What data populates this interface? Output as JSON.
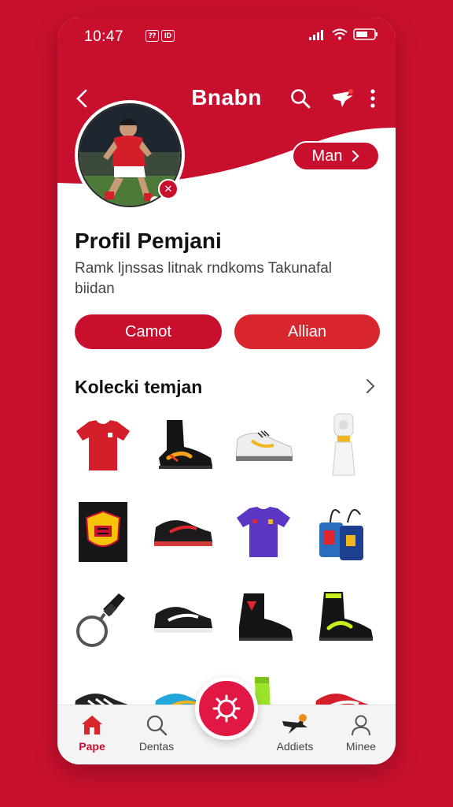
{
  "status_bar": {
    "time": "10:47",
    "notif": [
      "⁇",
      "ID"
    ]
  },
  "app_bar": {
    "title": "Bnabn"
  },
  "profile": {
    "more_label": "Man",
    "title": "Profil Pemjani",
    "description": "Ramk ljnssas litnak rndkoms Takunafal biidan",
    "primary_button": "Camot",
    "secondary_button": "Allian"
  },
  "collection": {
    "title": "Kolecki temjan",
    "items": [
      "red-jersey-icon",
      "black-boot-icon",
      "white-sneaker-icon",
      "bottle-icon",
      "badge-icon",
      "black-sneaker-icon",
      "purple-jersey-icon",
      "bag-icon",
      "keychain-icon",
      "black-sneaker-icon",
      "black-boot-icon",
      "black-boot-icon",
      "black-sneaker-icon",
      "blue-sneaker-icon",
      "green-sock-icon",
      "red-sneaker-icon"
    ]
  },
  "bottom_nav": {
    "items": [
      {
        "label": "Pape",
        "icon": "home-icon",
        "active": true
      },
      {
        "label": "Dentas",
        "icon": "search-icon",
        "active": false
      },
      {
        "label": "Addiets",
        "icon": "jet-icon",
        "active": false
      },
      {
        "label": "Minee",
        "icon": "person-icon",
        "active": false
      }
    ]
  },
  "colors": {
    "brand": "#c8102e",
    "fab": "#e11843",
    "background": "#ffffff"
  }
}
